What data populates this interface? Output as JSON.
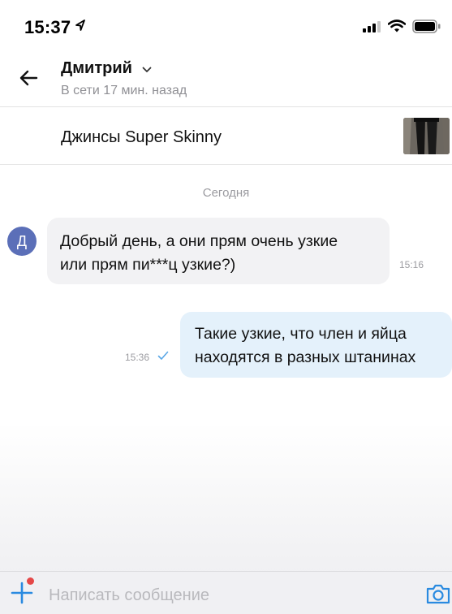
{
  "status_bar": {
    "time": "15:37"
  },
  "header": {
    "contact_name": "Дмитрий",
    "contact_status": "В сети 17 мин. назад"
  },
  "product": {
    "title": "Джинсы Super Skinny"
  },
  "chat": {
    "date_separator": "Сегодня",
    "avatar_letter": "Д",
    "messages": [
      {
        "direction": "incoming",
        "lines": [
          "Добрый день, а они прям очень узкие",
          "или прям пи***ц узкие?)"
        ],
        "time": "15:16"
      },
      {
        "direction": "outgoing",
        "lines": [
          "Такие узкие, что член и яйца",
          "находятся в разных штанинах"
        ],
        "time": "15:36"
      }
    ]
  },
  "composer": {
    "placeholder": "Написать сообщение"
  },
  "colors": {
    "accent": "#2a8ae0",
    "avatar": "#5b6fb8",
    "incoming_bubble": "#f2f2f4",
    "outgoing_bubble": "#e4f1fb",
    "notification_dot": "#e54848"
  },
  "icons": [
    "location-arrow-icon",
    "signal-icon",
    "wifi-icon",
    "battery-icon",
    "back-arrow-icon",
    "chevron-down-icon",
    "read-check-icon",
    "plus-icon",
    "camera-icon"
  ]
}
